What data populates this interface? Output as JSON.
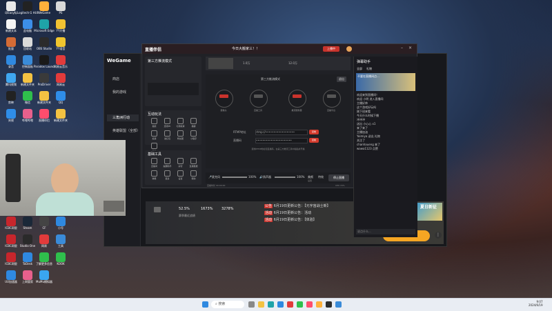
{
  "desktop": {
    "icons": [
      {
        "label": "印Easy标",
        "color": "#e8e8e8"
      },
      {
        "label": "Logitech G HUB",
        "color": "#222"
      },
      {
        "label": "WeGame",
        "color": "#ffb13b"
      },
      {
        "label": "PS",
        "color": "#d9d9d9"
      },
      {
        "label": "新建文本",
        "color": "#f4f4f4"
      },
      {
        "label": "此电脑",
        "color": "#3c8ee8"
      },
      {
        "label": "Microsoft Edge",
        "color": "#1fa3a8"
      },
      {
        "label": "YY开播",
        "color": "#f2c232"
      },
      {
        "label": "批量",
        "color": "#d46b35"
      },
      {
        "label": "回收站",
        "color": "#dadada"
      },
      {
        "label": "OBS Studio",
        "color": "#2b2b2b"
      },
      {
        "label": "YY语音",
        "color": "#f0c52e"
      },
      {
        "label": "录音",
        "color": "#2f89e0"
      },
      {
        "label": "控制面板",
        "color": "#3a8bd8"
      },
      {
        "label": "Paradox Launcher",
        "color": "#1a1a1a"
      },
      {
        "label": "网易云音乐",
        "color": "#e23b3b"
      },
      {
        "label": "腾讯视频",
        "color": "#3fa7f0"
      },
      {
        "label": "新建文件夹",
        "color": "#f3c242"
      },
      {
        "label": "ProDriver",
        "color": "#3a3a3a"
      },
      {
        "label": "网易云",
        "color": "#e23b3b"
      },
      {
        "label": "剪映",
        "color": "#222"
      },
      {
        "label": "微信",
        "color": "#2fbf4c"
      },
      {
        "label": "新建文件夹",
        "color": "#f3c242"
      },
      {
        "label": "QQ",
        "color": "#2f8de8"
      },
      {
        "label": "央视",
        "color": "#2f8de8"
      },
      {
        "label": "哔哩哔哩",
        "color": "#e8608c"
      },
      {
        "label": "直播伴侣",
        "color": "#ff4d6d"
      },
      {
        "label": "新建文件夹",
        "color": "#f3c242"
      },
      {
        "label": "ICBC网银",
        "color": "#c8262c"
      },
      {
        "label": "Steam",
        "color": "#1b2838"
      },
      {
        "label": "CF",
        "color": "#444"
      },
      {
        "label": "小号",
        "color": "#2f89e0"
      },
      {
        "label": "ICBC网银",
        "color": "#c8262c"
      },
      {
        "label": "Studio One",
        "color": "#2a2a2a"
      },
      {
        "label": "网易",
        "color": "#e23b3b"
      },
      {
        "label": "工具",
        "color": "#3a8bd8"
      },
      {
        "label": "ICBC网银",
        "color": "#c8262c"
      },
      {
        "label": "ToDesk",
        "color": "#2f89e0"
      },
      {
        "label": "了解更多信息",
        "color": "#2fbf4c"
      },
      {
        "label": "KOOK",
        "color": "#2fbf4c"
      },
      {
        "label": "UU加速器",
        "color": "#2f89e0"
      },
      {
        "label": "上网管家",
        "color": "#e8608c"
      },
      {
        "label": "MuMu模拟器",
        "color": "#3aa6f0"
      }
    ]
  },
  "wegame": {
    "logo": "WeGame",
    "sidebar": [
      {
        "label": "商店"
      },
      {
        "label": "我的游戏"
      },
      {
        "label": "三角洲行动"
      },
      {
        "label": "英雄联盟（全部）"
      }
    ],
    "banner": {
      "stats": [
        "52.5%",
        "1673%",
        "3278%"
      ],
      "stat_label": "赛季最近战绩",
      "news": [
        {
          "tag": "公告",
          "text": "6月19日更新公告：【元宇宙战士新】"
        },
        {
          "tag": "活动",
          "text": "6月19日更新公告：活动"
        },
        {
          "tag": "活动",
          "text": "6月19日更新公告：【体验】"
        }
      ],
      "promo_title": "S1",
      "promo_sub": "新赛季限时福利",
      "promo_text": "夏日新征",
      "start_label": "启动",
      "volume_label": "00"
    }
  },
  "live_tool": {
    "logo": "直播伴侣",
    "tab_title": "今日大搬家三！！",
    "status": "上播中",
    "tip": "第三方推流模式",
    "top_button": "退出",
    "toolbar_counts": [
      "1.0万",
      "12.0万"
    ],
    "left_panel_title": "第三方推流模式",
    "nodes": [
      "摄像头",
      "直播工具",
      "推流服务器",
      "直播平台"
    ],
    "fields": [
      {
        "label": "RTMP地址",
        "value": "rtmp://••••••••••••••••••",
        "action": "复制"
      },
      {
        "label": "直播码",
        "value": "••••••••••••••••••••••",
        "action": "复制"
      }
    ],
    "hint": "复制RTMP地址和直播码，在第三方推流工具中粘贴并开播",
    "section_interact": "互动玩法",
    "interact_items": [
      "抽奖",
      "连线PK",
      "礼物投票",
      "福袋",
      "投票",
      "发红包",
      "粉丝团",
      "小程序",
      "更多"
    ],
    "section_tools": "基础工具",
    "tool_items": [
      "直播间",
      "提醒助手",
      "房管",
      "直播数据",
      "弹幕",
      "更多",
      "设置",
      "帮助"
    ],
    "bottom_controls": [
      {
        "label": "麦克风",
        "pct": "100%"
      },
      {
        "label": "扬声器",
        "pct": "100%"
      },
      {
        "label": "美颜"
      },
      {
        "label": "特效"
      },
      {
        "label": "设置"
      }
    ],
    "go_live_button": "停止直播",
    "footer_left": "直播时长 00:00:00",
    "footer_right": "CPU 15%",
    "chat": {
      "title": "弹幕助手",
      "tabs": [
        "全部",
        "礼物"
      ],
      "banner": "不要在直播间点...",
      "lines": [
        "欢迎来到直播间！",
        "欢迎 小明 进入直播间",
        "主播好帅",
        "这个游戏好玩吗",
        "刚下班来看",
        "今天什么时候下播",
        "冲冲冲",
        "送出 小心心 x1",
        "来了来了",
        "主播加油",
        "Yoimiya 送出 礼物",
        "关注了",
        "chanhaueng 来了",
        "wawa1123 点赞"
      ],
      "input_placeholder": "说点什么..."
    }
  },
  "taskbar": {
    "search_label": "搜索",
    "time": "9:07",
    "date": "2024/6/19"
  }
}
